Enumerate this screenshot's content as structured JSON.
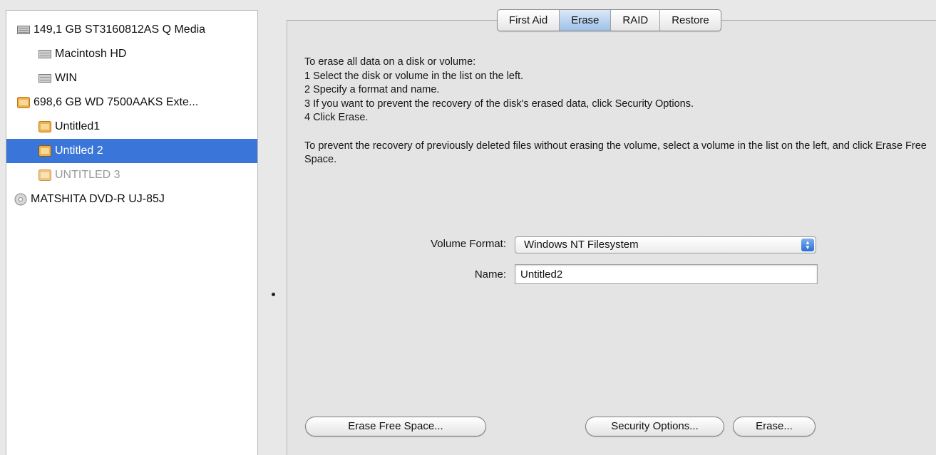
{
  "sidebar": {
    "items": [
      {
        "label": "149,1 GB ST3160812AS Q Media",
        "icon": "hard-disk-icon"
      },
      {
        "label": "Macintosh HD",
        "icon": "volume-icon"
      },
      {
        "label": "WIN",
        "icon": "volume-icon"
      },
      {
        "label": "698,6 GB WD 7500AAKS Exte...",
        "icon": "external-disk-icon"
      },
      {
        "label": "Untitled1",
        "icon": "external-volume-icon"
      },
      {
        "label": "Untitled 2",
        "icon": "external-volume-icon"
      },
      {
        "label": "UNTITLED 3",
        "icon": "external-volume-icon"
      },
      {
        "label": "MATSHITA DVD-R UJ-85J",
        "icon": "optical-drive-icon"
      }
    ],
    "selected_index": 5
  },
  "tabs": [
    {
      "label": "First Aid"
    },
    {
      "label": "Erase"
    },
    {
      "label": "RAID"
    },
    {
      "label": "Restore"
    }
  ],
  "active_tab": "Erase",
  "instructions": {
    "lines": [
      "To erase all data on a disk or volume:",
      "1 Select the disk or volume in the list on the left.",
      "2 Specify a format and name.",
      "3 If you want to prevent the recovery of the disk's erased data, click Security Options.",
      "4 Click Erase."
    ],
    "free_space_note": "To prevent the recovery of previously deleted files without erasing the volume, select a volume in the list on the left, and click Erase Free Space."
  },
  "form": {
    "volume_format_label": "Volume Format:",
    "volume_format_value": "Windows NT Filesystem",
    "name_label": "Name:",
    "name_value": "Untitled2"
  },
  "buttons": {
    "erase_free_space": "Erase Free Space...",
    "security_options": "Security Options...",
    "erase": "Erase..."
  },
  "colors": {
    "selection": "#3a75d9",
    "active_tab": "#9ec1ea",
    "disk_orange": "#e8a43a"
  }
}
